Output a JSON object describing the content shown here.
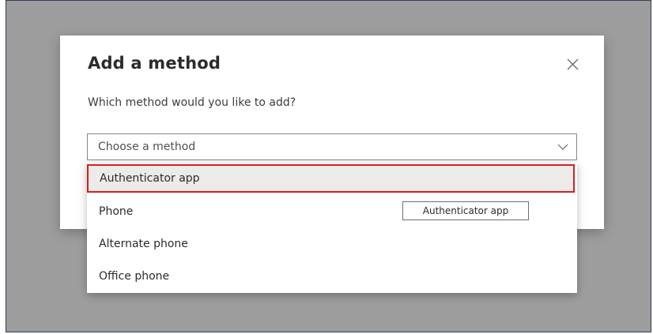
{
  "dialog": {
    "title": "Add a method",
    "subtitle": "Which method would you like to add?"
  },
  "select": {
    "placeholder": "Choose a method",
    "options": [
      {
        "label": "Authenticator app",
        "highlighted": true
      },
      {
        "label": "Phone"
      },
      {
        "label": "Alternate phone"
      },
      {
        "label": "Office phone"
      }
    ]
  },
  "tooltip": "Authenticator app",
  "icons": {
    "close": "close-icon",
    "dropdown": "chevron-down-icon"
  },
  "colors": {
    "highlight_border": "#d81f1f",
    "overlay": "#9d9d9d",
    "selected_bg": "#edebe9"
  }
}
